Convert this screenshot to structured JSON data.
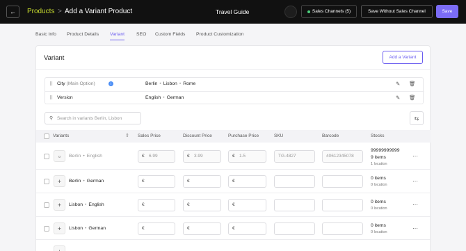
{
  "topbar": {
    "back_icon": "arrow-left-icon",
    "breadcrumb_root": "Products",
    "breadcrumb_sep": ">",
    "page_title": "Add a Variant Product",
    "center_title": "Travel Guide",
    "sales_channels_label": "Sales Channels (5)",
    "save_without_label": "Save Without Sales Channel",
    "save_label": "Save"
  },
  "tabs": [
    "Basic Info",
    "Product Details",
    "Variant",
    "SEO",
    "Custom Fields",
    "Product Customization"
  ],
  "active_tab": "Variant",
  "card": {
    "title": "Variant",
    "add_variant_label": "Add a Variant"
  },
  "options": [
    {
      "name": "City",
      "tag": "(Main Option)",
      "info": "i",
      "values": [
        "Berlin",
        "Lisbon",
        "Rome"
      ]
    },
    {
      "name": "Version",
      "tag": "",
      "info": "",
      "values": [
        "English",
        "German"
      ]
    }
  ],
  "search": {
    "placeholder": "Search in variants Berlin, Lisbon"
  },
  "table": {
    "headers": {
      "variants": "Variants",
      "sales_price": "Sales Price",
      "discount_price": "Discount Price",
      "purchase_price": "Purchase Price",
      "sku": "SKU",
      "barcode": "Barcode",
      "stocks": "Stocks"
    },
    "currency": "€",
    "rows": [
      {
        "city": "Berlin",
        "version": "English",
        "sales": "6.99",
        "discount": "3.99",
        "purchase": "1.5",
        "sku": "TG-4827",
        "barcode": "40612345078",
        "stock_qty": "99999999999",
        "items": "9 items",
        "locations": "1 location"
      },
      {
        "city": "Berlin",
        "version": "German",
        "sales": "",
        "discount": "",
        "purchase": "",
        "sku": "",
        "barcode": "",
        "stock_qty": "",
        "items": "0 items",
        "locations": "0 location"
      },
      {
        "city": "Lisbon",
        "version": "English",
        "sales": "",
        "discount": "",
        "purchase": "",
        "sku": "",
        "barcode": "",
        "stock_qty": "",
        "items": "0 items",
        "locations": "0 location"
      },
      {
        "city": "Lisbon",
        "version": "German",
        "sales": "",
        "discount": "",
        "purchase": "",
        "sku": "",
        "barcode": "",
        "stock_qty": "",
        "items": "0 items",
        "locations": "0 location"
      }
    ]
  },
  "colors": {
    "accent": "#6a5cf0",
    "breadcrumb": "#c5d92f",
    "topbar": "#111111",
    "channel_dot": "#4cd07d"
  }
}
